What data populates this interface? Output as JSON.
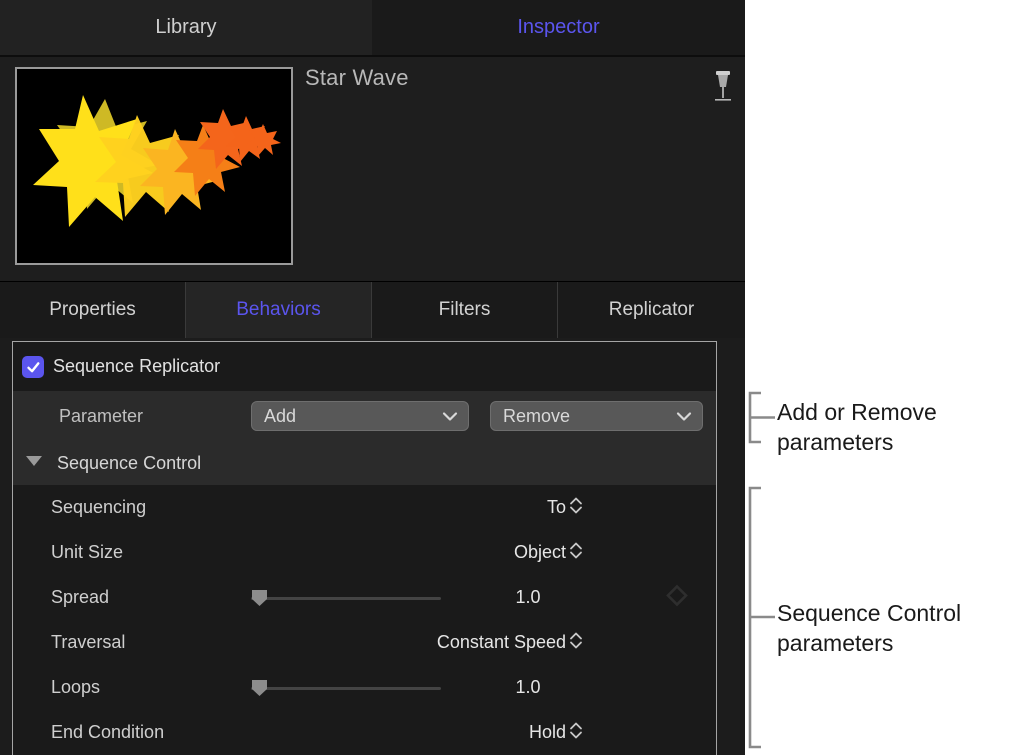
{
  "top_tabs": [
    {
      "label": "Library",
      "active": false
    },
    {
      "label": "Inspector",
      "active": true
    }
  ],
  "preview": {
    "object_title": "Star Wave",
    "pin_icon": "pin-icon",
    "thumbnail_alt": "star-wave-replicator-thumbnail"
  },
  "category_tabs": [
    {
      "label": "Properties",
      "active": false
    },
    {
      "label": "Behaviors",
      "active": true
    },
    {
      "label": "Filters",
      "active": false
    },
    {
      "label": "Replicator",
      "active": false
    }
  ],
  "behavior": {
    "enabled": true,
    "name": "Sequence Replicator",
    "parameter_label": "Parameter",
    "add_label": "Add",
    "remove_label": "Remove"
  },
  "group": {
    "title": "Sequence Control",
    "expanded": true,
    "disclosure_icon": "triangle-down-icon"
  },
  "parameters": [
    {
      "label": "Sequencing",
      "value": "To",
      "control": "stepper"
    },
    {
      "label": "Unit Size",
      "value": "Object",
      "control": "stepper"
    },
    {
      "label": "Spread",
      "value": "1.0",
      "control": "slider",
      "slider_percent": 0,
      "keyframe": true
    },
    {
      "label": "Traversal",
      "value": "Constant Speed",
      "control": "stepper"
    },
    {
      "label": "Loops",
      "value": "1.0",
      "control": "slider",
      "slider_percent": 0,
      "keyframe": false
    },
    {
      "label": "End Condition",
      "value": "Hold",
      "control": "stepper"
    }
  ],
  "callouts": [
    {
      "text": "Add or Remove parameters"
    },
    {
      "text": "Sequence Control parameters"
    }
  ],
  "colors": {
    "accent_blue": "#5b55ee",
    "panel_bg": "#1c1c1c",
    "row_dark": "#1a1a1a",
    "row_light": "#2b2b2b",
    "text_primary": "#e2e2e2",
    "callout_bg": "#ffffff",
    "bracket_gray": "#8a8a8a"
  }
}
